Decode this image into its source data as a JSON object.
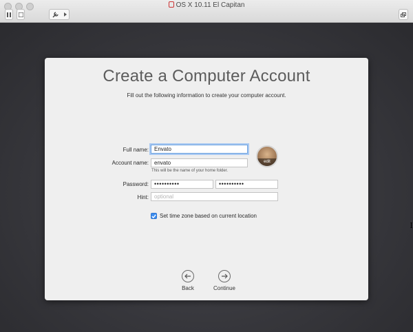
{
  "window": {
    "title": "OS X 10.11 El Capitan"
  },
  "setup": {
    "heading": "Create a Computer Account",
    "subtitle": "Fill out the following information to create your computer account.",
    "full_name": {
      "label": "Full name:",
      "value": "Envato"
    },
    "account_name": {
      "label": "Account name:",
      "value": "envato",
      "hint": "This will be the name of your home folder."
    },
    "password": {
      "label": "Password:",
      "value": "••••••••••",
      "verify_value": "••••••••••"
    },
    "hint": {
      "label": "Hint:",
      "placeholder": "optional"
    },
    "avatar_edit_label": "edit",
    "timezone_checkbox": {
      "label": "Set time zone based on current location",
      "checked": true
    },
    "back_label": "Back",
    "continue_label": "Continue"
  },
  "colors": {
    "accent": "#3d8ef0",
    "focus_ring": "#a9c9f2"
  }
}
